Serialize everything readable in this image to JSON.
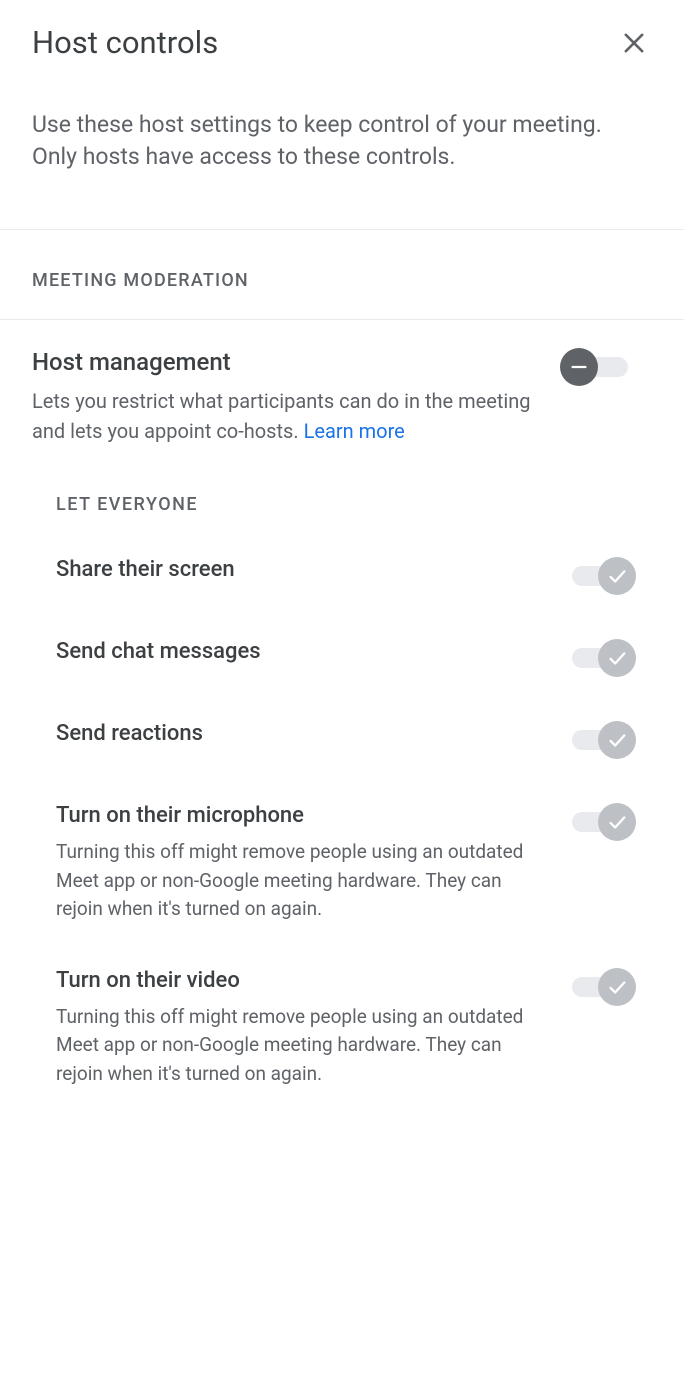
{
  "header": {
    "title": "Host controls"
  },
  "intro_text": "Use these host settings to keep control of your meeting. Only hosts have access to these controls.",
  "section_header": "MEETING MODERATION",
  "host_management": {
    "title": "Host management",
    "description": "Lets you restrict what participants can do in the meeting and lets you appoint co-hosts. ",
    "link_text": "Learn more"
  },
  "let_everyone_header": "LET EVERYONE",
  "settings": {
    "share_screen": {
      "title": "Share their screen"
    },
    "send_chat": {
      "title": "Send chat messages"
    },
    "send_reactions": {
      "title": "Send reactions"
    },
    "microphone": {
      "title": "Turn on their microphone",
      "description": "Turning this off might remove people using an outdated Meet app or non-Google meeting hardware. They can rejoin when it's turned on again."
    },
    "video": {
      "title": "Turn on their video",
      "description": "Turning this off might remove people using an outdated Meet app or non-Google meeting hardware. They can rejoin when it's turned on again."
    }
  }
}
